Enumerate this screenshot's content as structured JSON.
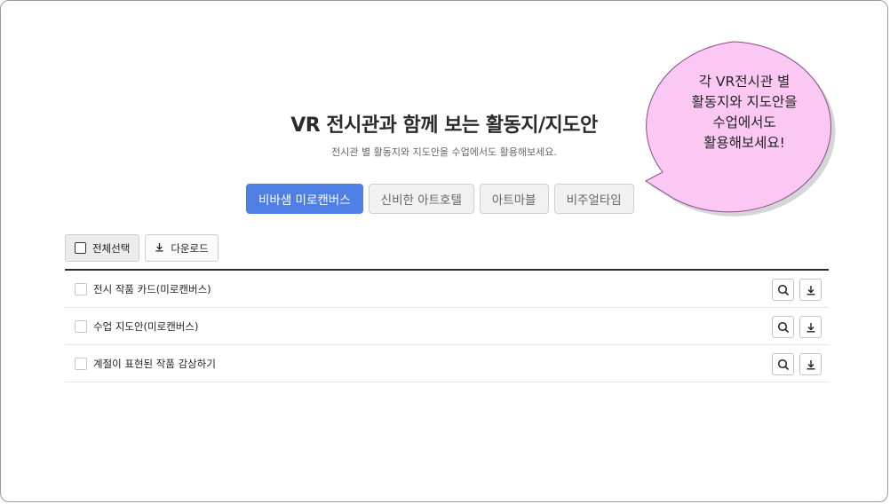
{
  "header": {
    "title": "VR 전시관과 함께 보는 활동지/지도안",
    "subtitle": "전시관 별 활동지와 지도안을 수업에서도 활용해보세요."
  },
  "tabs": [
    {
      "label": "비바샘 미로캔버스",
      "active": true
    },
    {
      "label": "신비한 아트호텔",
      "active": false
    },
    {
      "label": "아트마블",
      "active": false
    },
    {
      "label": "비주얼타임",
      "active": false
    }
  ],
  "toolbar": {
    "select_all_label": "전체선택",
    "download_label": "다운로드"
  },
  "list": {
    "items": [
      {
        "label": "전시 작품 카드(미로캔버스)"
      },
      {
        "label": "수업 지도안(미로캔버스)"
      },
      {
        "label": "계절이 표현된 작품 감상하기"
      }
    ]
  },
  "callout": {
    "lines": [
      "각 VR전시관 별",
      "활동지와 지도안을",
      "수업에서도",
      "활용해보세요!"
    ]
  },
  "colors": {
    "accent": "#4d7fe5",
    "callout_fill": "#fbc8f3",
    "callout_stroke": "#8a4a8a"
  }
}
